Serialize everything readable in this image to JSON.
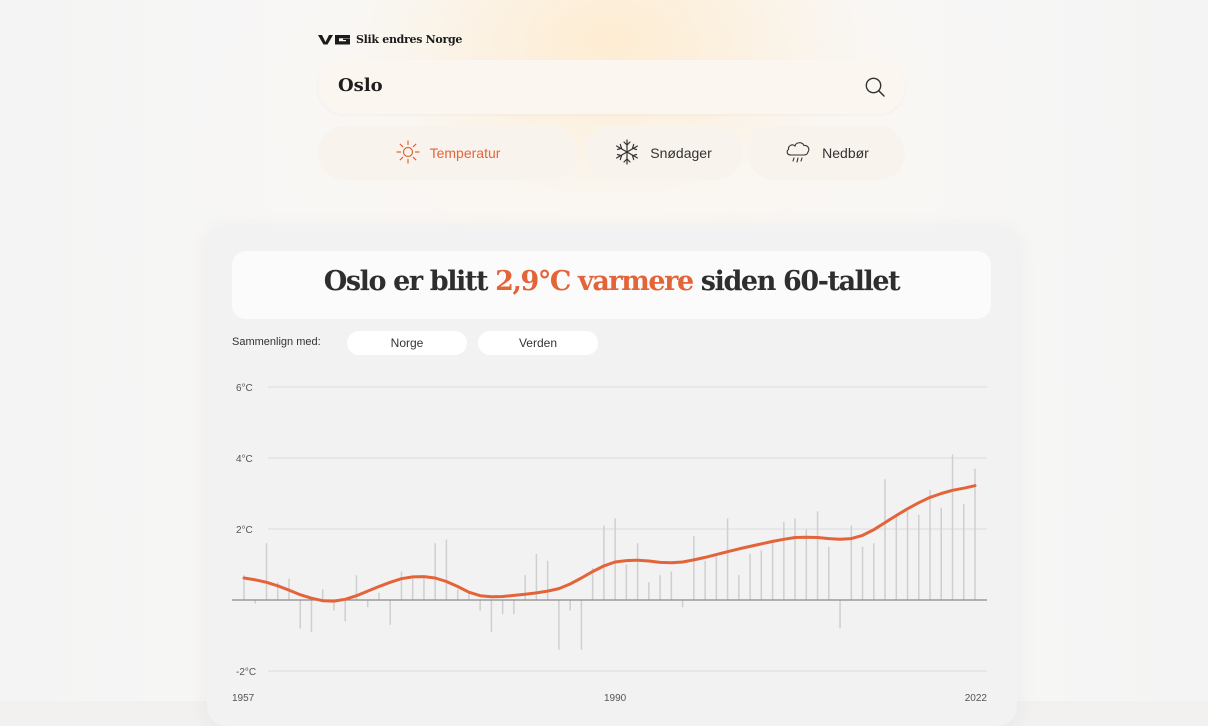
{
  "header": {
    "brand": "VG",
    "site_title": "Slik endres Norge"
  },
  "search": {
    "value": "Oslo",
    "icon": "search-icon"
  },
  "tabs": [
    {
      "label": "Temperatur",
      "icon": "sun-icon",
      "active": true
    },
    {
      "label": "Snødager",
      "icon": "snowflake-icon",
      "active": false
    },
    {
      "label": "Nedbør",
      "icon": "rain-cloud-icon",
      "active": false
    }
  ],
  "headline": {
    "prefix": "Oslo er blitt ",
    "highlight": "2,9°C varmere",
    "suffix": " siden 60-tallet"
  },
  "compare": {
    "label": "Sammenlign med:",
    "options": [
      "Norge",
      "Verden"
    ]
  },
  "colors": {
    "accent": "#e4643a",
    "bar": "#cfcfcf",
    "grid": "#dcdcdc",
    "zero_line": "#8a8a8a"
  },
  "chart_data": {
    "type": "bar",
    "title": "",
    "xlabel": "",
    "ylabel": "",
    "ylim": [
      -2,
      6
    ],
    "y_ticks": [
      "6°C",
      "4°C",
      "2°C",
      "-2°C"
    ],
    "y_tick_values": [
      6,
      4,
      2,
      -2
    ],
    "x_tick_labels": [
      "1957",
      "1990",
      "2022"
    ],
    "x_tick_values": [
      1957,
      1990,
      2022
    ],
    "grid": true,
    "x": [
      1957,
      1958,
      1959,
      1960,
      1961,
      1962,
      1963,
      1964,
      1965,
      1966,
      1967,
      1968,
      1969,
      1970,
      1971,
      1972,
      1973,
      1974,
      1975,
      1976,
      1977,
      1978,
      1979,
      1980,
      1981,
      1982,
      1983,
      1984,
      1985,
      1986,
      1987,
      1988,
      1989,
      1990,
      1991,
      1992,
      1993,
      1994,
      1995,
      1996,
      1997,
      1998,
      1999,
      2000,
      2001,
      2002,
      2003,
      2004,
      2005,
      2006,
      2007,
      2008,
      2009,
      2010,
      2011,
      2012,
      2013,
      2014,
      2015,
      2016,
      2017,
      2018,
      2019,
      2020,
      2021,
      2022
    ],
    "series": [
      {
        "kind": "bar",
        "values": [
          0.7,
          -0.1,
          1.6,
          0.5,
          0.6,
          -0.8,
          -0.9,
          0.3,
          -0.3,
          -0.6,
          0.7,
          -0.2,
          0.2,
          -0.7,
          0.8,
          0.6,
          0.7,
          1.6,
          1.7,
          0.3,
          0.2,
          -0.3,
          -0.9,
          -0.4,
          -0.4,
          0.7,
          1.3,
          1.1,
          -1.4,
          -0.3,
          -1.4,
          0.9,
          2.1,
          2.3,
          1.0,
          1.6,
          0.5,
          0.7,
          0.8,
          -0.2,
          1.8,
          1.1,
          1.3,
          2.3,
          0.7,
          1.3,
          1.4,
          1.6,
          2.2,
          2.3,
          2.0,
          2.5,
          1.5,
          -0.8,
          2.1,
          1.5,
          1.6,
          3.4,
          2.4,
          2.5,
          2.4,
          3.1,
          2.6,
          4.1,
          2.7,
          3.7
        ]
      },
      {
        "kind": "line",
        "values": [
          0.62,
          0.57,
          0.5,
          0.4,
          0.28,
          0.15,
          0.05,
          -0.02,
          -0.03,
          0.02,
          0.12,
          0.25,
          0.38,
          0.5,
          0.6,
          0.65,
          0.66,
          0.62,
          0.52,
          0.38,
          0.22,
          0.12,
          0.09,
          0.1,
          0.13,
          0.16,
          0.2,
          0.25,
          0.32,
          0.45,
          0.62,
          0.8,
          0.96,
          1.07,
          1.11,
          1.12,
          1.1,
          1.06,
          1.05,
          1.07,
          1.13,
          1.2,
          1.28,
          1.36,
          1.44,
          1.51,
          1.58,
          1.65,
          1.71,
          1.76,
          1.77,
          1.76,
          1.73,
          1.71,
          1.73,
          1.82,
          1.98,
          2.18,
          2.38,
          2.57,
          2.74,
          2.89,
          3.0,
          3.09,
          3.15,
          3.22
        ]
      }
    ]
  }
}
